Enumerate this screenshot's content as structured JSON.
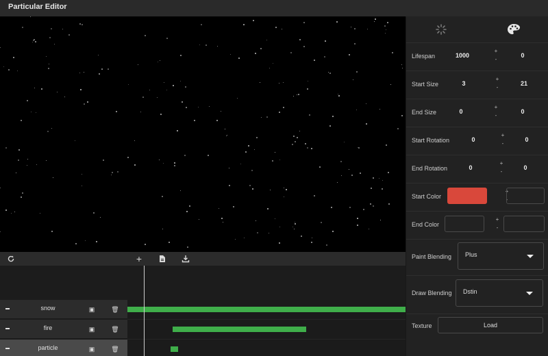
{
  "app": {
    "title": "Particular Editor"
  },
  "toolbar": {
    "refresh_icon": "refresh-icon",
    "add_icon": "plus-icon",
    "file_icon": "file-icon",
    "download_icon": "download-icon"
  },
  "tracks": [
    {
      "name": "snow",
      "active": false
    },
    {
      "name": "fire",
      "active": false
    },
    {
      "name": "particle",
      "active": true
    }
  ],
  "panel": {
    "tabs": [
      "spinner-icon",
      "palette-icon"
    ],
    "lifespan": {
      "label": "Lifespan",
      "value": "1000",
      "variance": "0"
    },
    "start_size": {
      "label": "Start Size",
      "value": "3",
      "variance": "21"
    },
    "end_size": {
      "label": "End Size",
      "value": "0",
      "variance": "0"
    },
    "start_rotation": {
      "label": "Start Rotation",
      "value": "0",
      "variance": "0"
    },
    "end_rotation": {
      "label": "End Rotation",
      "value": "0",
      "variance": "0"
    },
    "start_color": {
      "label": "Start Color",
      "color": "#d9483b"
    },
    "end_color": {
      "label": "End Color"
    },
    "paint_blending": {
      "label": "Paint Blending",
      "value": "Plus"
    },
    "draw_blending": {
      "label": "Draw Blending",
      "value": "Dstin"
    },
    "texture": {
      "label": "Texture",
      "button": "Load"
    },
    "plus_sign": "+",
    "minus_sign": "-"
  },
  "colors": {
    "accent_green": "#3fae4a",
    "background": "#000000"
  }
}
